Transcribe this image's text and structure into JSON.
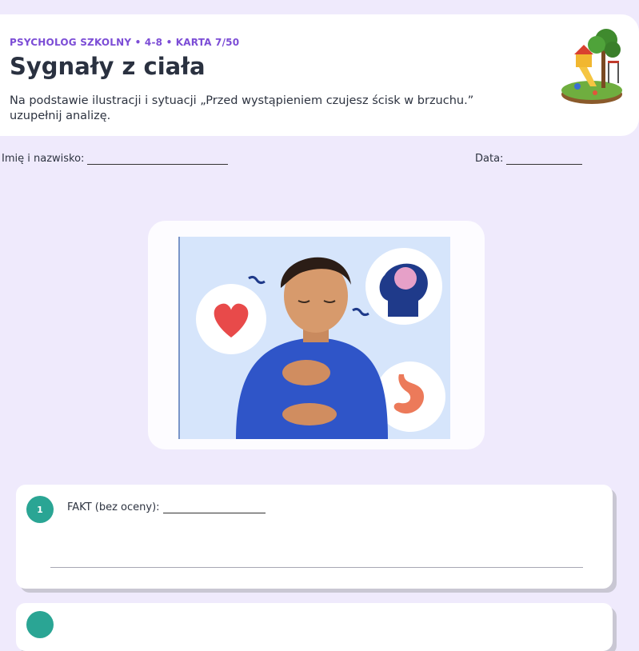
{
  "header": {
    "kicker": "PSYCHOLOG SZKOLNY • 4-8 • KARTA 7/50",
    "title": "Sygnały z ciała",
    "subtitle": "Na podstawie ilustracji i sytuacji „Przed wystąpieniem czujesz ścisk w brzuchu.” uzupełnij analizę."
  },
  "fields": {
    "name_label": "Imię i nazwisko:",
    "date_label": "Data:"
  },
  "questions": [
    {
      "number": "1",
      "label": "FAKT (bez oceny):"
    }
  ],
  "colors": {
    "background": "#efeafc",
    "kicker": "#7c4dd6",
    "badge": "#2aa594"
  }
}
